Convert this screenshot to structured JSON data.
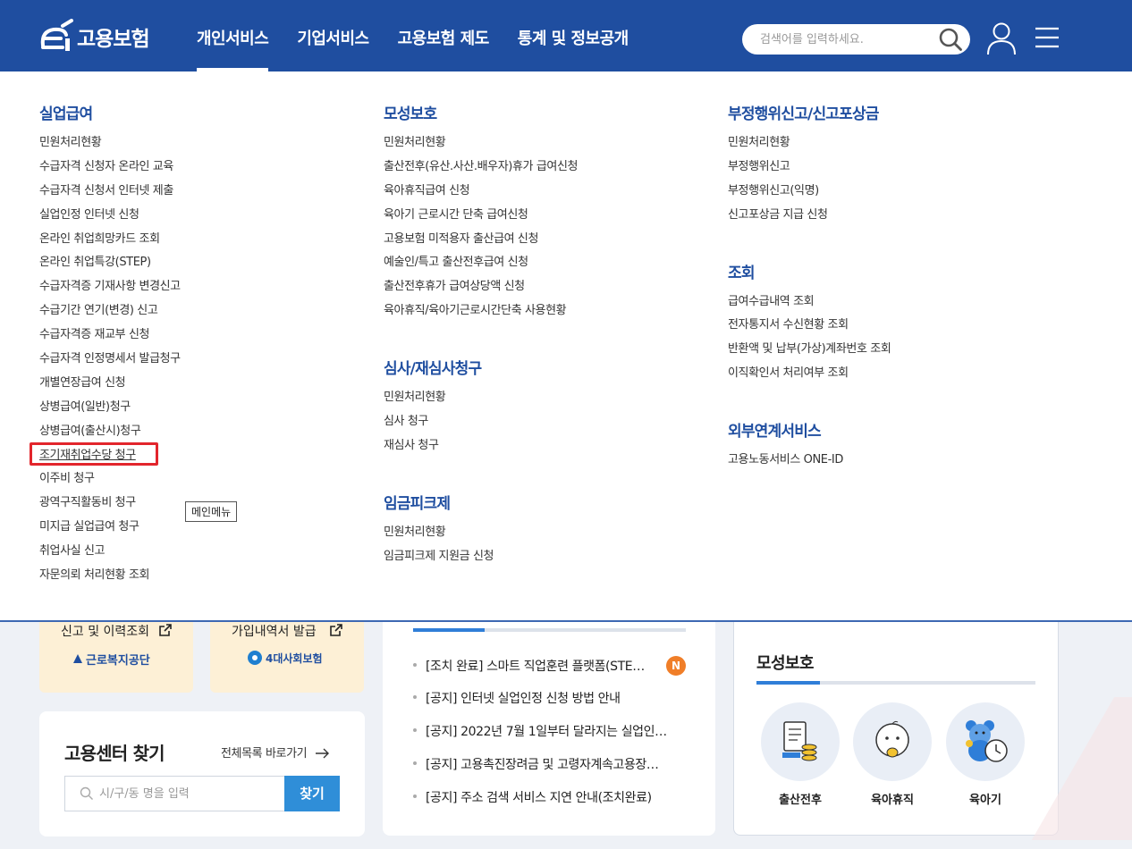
{
  "header": {
    "logo_text": "고용보험",
    "nav": [
      "개인서비스",
      "기업서비스",
      "고용보험 제도",
      "통계 및 정보공개"
    ],
    "active_nav": "개인서비스",
    "search_placeholder": "검색어를 입력하세요."
  },
  "mega_menu": {
    "col1": [
      {
        "title": "실업급여",
        "items": [
          "민원처리현황",
          "수급자격 신청자 온라인 교육",
          "수급자격 신청서 인터넷 제출",
          "실업인정 인터넷 신청",
          "온라인 취업희망카드 조회",
          "온라인 취업특강(STEP)",
          "수급자격증 기재사항 변경신고",
          "수급기간 연기(변경) 신고",
          "수급자격증 재교부 신청",
          "수급자격 인정명세서 발급청구",
          "개별연장급여 신청",
          "상병급여(일반)청구",
          "상병급여(출산시)청구",
          "조기재취업수당 청구",
          "이주비 청구",
          "광역구직활동비 청구",
          "미지급 실업급여 청구",
          "취업사실 신고",
          "자문의뢰 처리현황 조회"
        ]
      }
    ],
    "col2": [
      {
        "title": "모성보호",
        "items": [
          "민원처리현황",
          "출산전후(유산.사산.배우자)휴가 급여신청",
          "육아휴직급여 신청",
          "육아기 근로시간 단축 급여신청",
          "고용보험 미적용자 출산급여 신청",
          "예술인/특고 출산전후급여 신청",
          "출산전후휴가 급여상당액 신청",
          "육아휴직/육아기근로시간단축 사용현황"
        ]
      },
      {
        "title": "심사/재심사청구",
        "items": [
          "민원처리현황",
          "심사 청구",
          "재심사 청구"
        ]
      },
      {
        "title": "임금피크제",
        "items": [
          "민원처리현황",
          "임금피크제 지원금 신청"
        ]
      }
    ],
    "col3": [
      {
        "title": "부정행위신고/신고포상금",
        "items": [
          "민원처리현황",
          "부정행위신고",
          "부정행위신고(익명)",
          "신고포상금 지급 신청"
        ]
      },
      {
        "title": "조회",
        "items": [
          "급여수급내역 조회",
          "전자통지서 수신현황 조회",
          "반환액 및 납부(가상)계좌번호 조회",
          "이직확인서 처리여부 조회"
        ]
      },
      {
        "title": "외부연계서비스",
        "items": [
          "고용노동서비스 ONE-ID"
        ]
      }
    ],
    "focused_item": "조기재취업수당 청구",
    "tooltip": "메인메뉴"
  },
  "background": {
    "service_cards": [
      {
        "link": "신고 및 이력조회",
        "org": "근로복지공단"
      },
      {
        "link": "가입내역서 발급",
        "org": "4대사회보험"
      }
    ],
    "notices": [
      "[조치 완료] 스마트 직업훈련 플랫폼(STE…",
      "[공지] 인터넷 실업인정 신청 방법 안내",
      "[공지] 2022년 7월 1일부터 달라지는 실업인…",
      "[공지] 고용촉진장려금 및 고령자계속고용장…",
      "[공지] 주소 검색 서비스 지연 안내(조치완료)"
    ],
    "new_badge": "N",
    "center": {
      "title": "고용센터 찾기",
      "more": "전체목록 바로가기",
      "input_placeholder": "시/구/동 명을 입력",
      "button": "찾기"
    },
    "maternity": {
      "title": "모성보호",
      "items": [
        "출산전후",
        "육아휴직",
        "육아기"
      ]
    }
  },
  "colors": {
    "header_bg": "#1f4ea0",
    "menu_title": "#1f4ea0",
    "focus_ring": "#e2252c",
    "accent": "#2f7ed8"
  }
}
